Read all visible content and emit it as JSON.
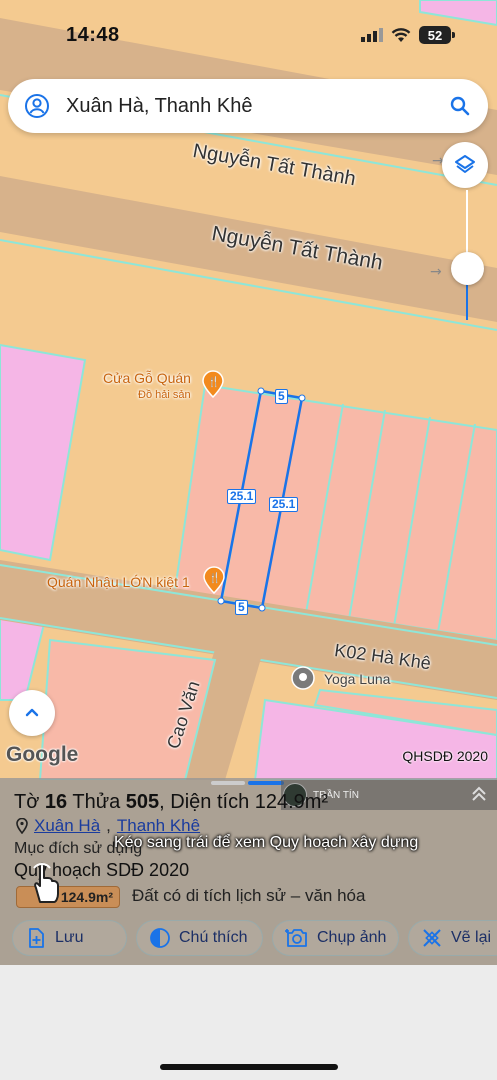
{
  "status_bar": {
    "time": "14:48",
    "battery": "52"
  },
  "search": {
    "text": "Xuân Hà, Thanh Khê"
  },
  "map": {
    "streets": [
      "Nguyễn Tất Thành",
      "Nguyễn Tất Thành",
      "K02 Hà Khê",
      "Cao Văn"
    ],
    "pois": [
      {
        "name": "Cửa Gỗ Quán",
        "sub": "Đồ hải sản"
      },
      {
        "name": "Quán Nhậu LỚN kiệt 1"
      },
      {
        "name": "Yoga Luna"
      }
    ],
    "dimensions": {
      "width_top": "5",
      "length_left": "25.1",
      "length_right": "25.1",
      "width_bottom": "5"
    },
    "google": "Google",
    "layer_label": "QHSDĐ 2020"
  },
  "sheet": {
    "user_name": "TRẦN TÍN",
    "title_prefix": "Tờ",
    "sheet_no": "16",
    "title_mid": "Thửa",
    "parcel_no": "505",
    "title_suffix": ", Diện tích 124.9m²",
    "ward": "Xuân Hà",
    "district": "Thanh Khê",
    "purpose_label": "Mục đích sử dụng",
    "plan_label": "Quy hoạch SDĐ 2020",
    "area_badge": "124.9m²",
    "land_type": "Đất có di tích lịch sử – văn hóa",
    "hint": "Kéo sang trái để xem Quy hoạch xây dựng"
  },
  "actions": [
    {
      "label": "Lưu",
      "icon": "add-file-icon"
    },
    {
      "label": "Chú thích",
      "icon": "legend-icon"
    },
    {
      "label": "Chụp ảnh",
      "icon": "camera-icon"
    },
    {
      "label": "Vẽ lại",
      "icon": "redraw-icon"
    }
  ],
  "colors": {
    "accent": "#1a73e8",
    "road": "#d5b08a",
    "land": "#f4ca90",
    "residential": "#f8b9a8",
    "pink": "#f5b6e6"
  }
}
